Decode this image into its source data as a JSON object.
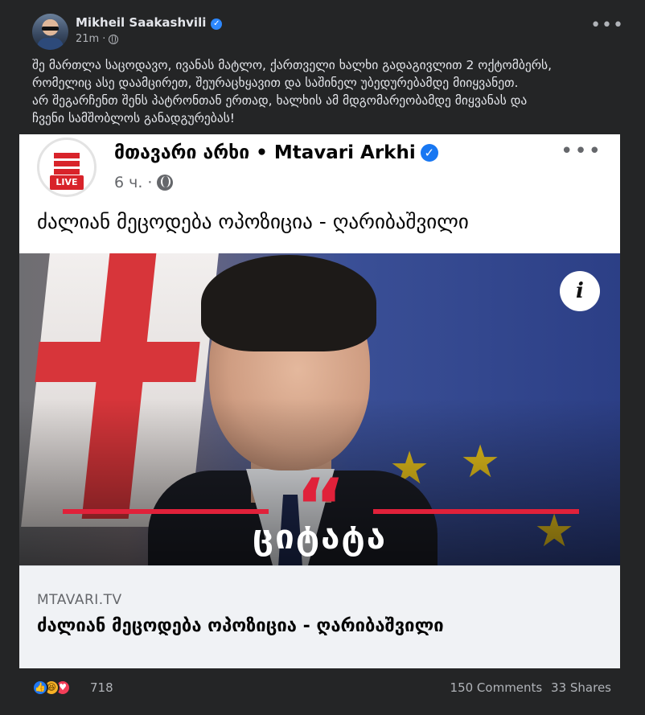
{
  "post": {
    "author": "Mikheil Saakashvili",
    "verified": true,
    "time": "21m",
    "privacy_icon": "globe-icon",
    "text": "შე მართლა საცოდავო, ივანას მატლო, ქართველი ხალხი გადაგივლით 2 ოქტომბერს,\nრომელიც ასე დაამცირეთ, შეურაცხყავით და საშინელ უბედურებამდე მიიყვანეთ.\nარ შეგარჩენთ შენს პატრონთან ერთად, ხალხის ამ მდგომარეობამდე მიყვანას და\nჩვენი სამშობლოს განადგურებას!"
  },
  "shared": {
    "page_name": "მთავარი არხი • Mtavari Arkhi",
    "logo_badge": "LIVE",
    "time": "6 ч.",
    "title": "ძალიან მეცოდება ოპოზიცია - ღარიბაშვილი",
    "image_overlay_text": "ციტატა",
    "quote_mark": "“",
    "info_icon_label": "i",
    "link_domain": "MTAVARI.TV",
    "link_title": "ძალიან მეცოდება ოპოზიცია - ღარიბაშვილი"
  },
  "footer": {
    "reaction_count": "718",
    "comments": "150 Comments",
    "shares": "33 Shares"
  },
  "colors": {
    "background": "#242526",
    "accent_blue": "#2d88ff",
    "quote_red": "#e0213a"
  }
}
